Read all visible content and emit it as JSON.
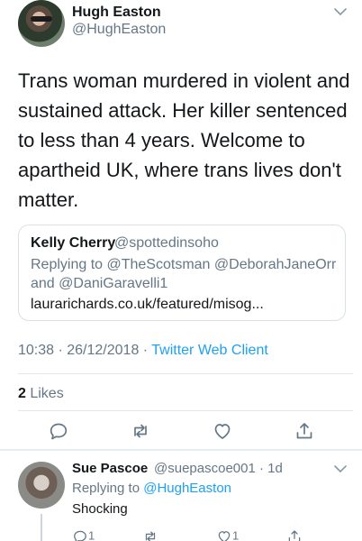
{
  "tweet": {
    "name": "Hugh Easton",
    "handle": "@HughEaston",
    "text": "Trans woman murdered in violent and sustained attack. Her killer sentenced to less than 4 years. Welcome to apartheid UK, where trans lives don't matter.",
    "timestamp": "10:38 · 26/12/2018 · ",
    "client": "Twitter Web Client",
    "likes_count": "2",
    "likes_label": " Likes"
  },
  "quote": {
    "name": "Kelly Cherry",
    "handle": "@spottedinsoho",
    "replying": "Replying to @TheScotsman @DeborahJaneOrr and @DaniGaravelli1",
    "link": "laurarichards.co.uk/featured/misog..."
  },
  "reply": {
    "name": "Sue Pascoe",
    "handle": "@suepascoe001 · 1d",
    "replying_prefix": "Replying to ",
    "replying_to": "@HughEaston",
    "text": "Shocking",
    "reply_count": "1",
    "like_count": "1"
  },
  "icons": {
    "reply": "reply-icon",
    "retweet": "retweet-icon",
    "like": "heart-icon",
    "share": "share-icon",
    "more": "chevron-down-icon"
  },
  "colors": {
    "accent": "#1da1f2",
    "text": "#14171a",
    "muted": "#657786",
    "border": "#e1e8ed"
  }
}
